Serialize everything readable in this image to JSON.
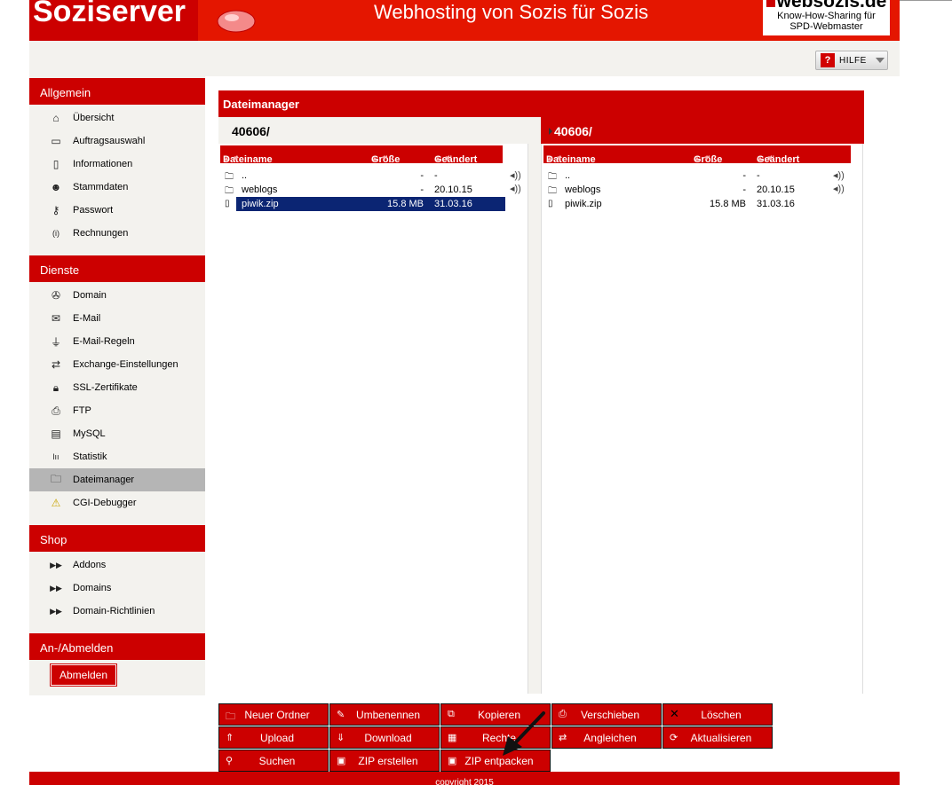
{
  "header": {
    "brand": "Soziserver",
    "tagline": "Webhosting von Sozis für Sozis",
    "partner_name": "websozis.de",
    "partner_sub_1": "Know-How-Sharing für",
    "partner_sub_2": "SPD-Webmaster"
  },
  "help": {
    "icon": "?",
    "label": "HILFE"
  },
  "sidebar": {
    "sections": [
      {
        "title": "Allgemein"
      },
      {
        "title": "Dienste"
      },
      {
        "title": "Shop"
      },
      {
        "title": "An-/Abmelden"
      }
    ],
    "allgemein": [
      {
        "label": "Übersicht",
        "icon": "home-icon"
      },
      {
        "label": "Auftragsauswahl",
        "icon": "window-icon"
      },
      {
        "label": "Informationen",
        "icon": "document-icon"
      },
      {
        "label": "Stammdaten",
        "icon": "user-icon"
      },
      {
        "label": "Passwort",
        "icon": "key-icon"
      },
      {
        "label": "Rechnungen",
        "icon": "info-icon"
      }
    ],
    "dienste": [
      {
        "label": "Domain",
        "icon": "globe-icon"
      },
      {
        "label": "E-Mail",
        "icon": "mail-icon"
      },
      {
        "label": "E-Mail-Regeln",
        "icon": "filter-icon"
      },
      {
        "label": "Exchange-Einstellungen",
        "icon": "exchange-icon"
      },
      {
        "label": "SSL-Zertifikate",
        "icon": "lock-icon"
      },
      {
        "label": "FTP",
        "icon": "ftp-icon"
      },
      {
        "label": "MySQL",
        "icon": "database-icon"
      },
      {
        "label": "Statistik",
        "icon": "chart-icon"
      },
      {
        "label": "Dateimanager",
        "icon": "folder-icon"
      },
      {
        "label": "CGI-Debugger",
        "icon": "warning-icon"
      }
    ],
    "shop": [
      {
        "label": "Addons",
        "icon": "forward-icon"
      },
      {
        "label": "Domains",
        "icon": "forward-icon"
      },
      {
        "label": "Domain-Richtlinien",
        "icon": "forward-icon"
      }
    ],
    "logout_label": "Abmelden"
  },
  "filemanager": {
    "title": "Dateimanager",
    "left_path": "40606/",
    "right_path": "40606/",
    "columns": {
      "name": "Dateiname",
      "size": "Größe",
      "changed": "Geändert"
    },
    "left_files": [
      {
        "name": "..",
        "size": "-",
        "changed": "-",
        "type": "folder"
      },
      {
        "name": "weblogs",
        "size": "-",
        "changed": "20.10.15",
        "type": "folder"
      },
      {
        "name": "piwik.zip",
        "size": "15.8 MB",
        "changed": "31.03.16",
        "type": "file"
      }
    ],
    "right_files": [
      {
        "name": "..",
        "size": "-",
        "changed": "-",
        "type": "folder"
      },
      {
        "name": "weblogs",
        "size": "-",
        "changed": "20.10.15",
        "type": "folder"
      },
      {
        "name": "piwik.zip",
        "size": "15.8 MB",
        "changed": "31.03.16",
        "type": "file"
      }
    ]
  },
  "toolbar": {
    "new_folder": "Neuer Ordner",
    "rename": "Umbenennen",
    "copy": "Kopieren",
    "move": "Verschieben",
    "delete": "Löschen",
    "upload": "Upload",
    "download": "Download",
    "rights": "Rechte",
    "sync": "Angleichen",
    "refresh": "Aktualisieren",
    "search": "Suchen",
    "zip_create": "ZIP erstellen",
    "zip_extract": "ZIP entpacken"
  },
  "footer": {
    "copyright": "copyright 2015"
  },
  "colors": {
    "accent": "#cc0000",
    "selection": "#0b2573",
    "panel": "#f3f2ee"
  }
}
